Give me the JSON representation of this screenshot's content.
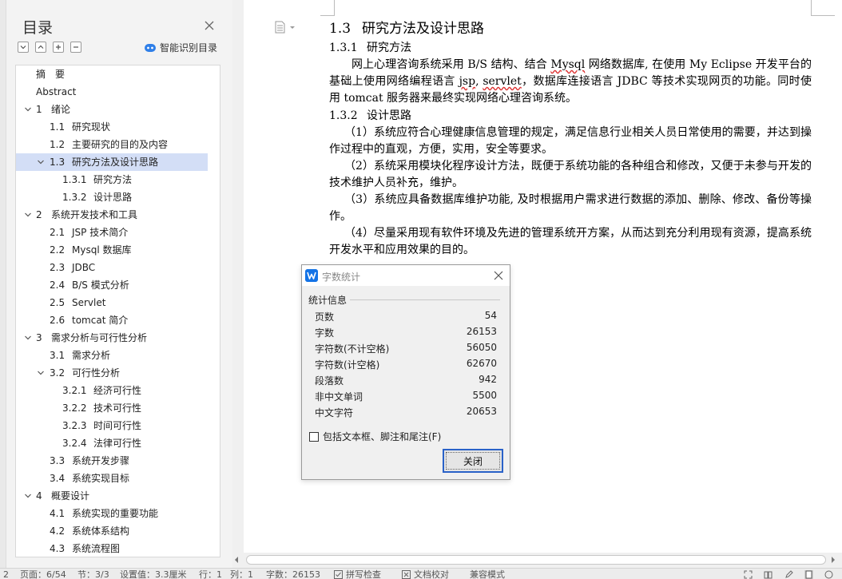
{
  "toc": {
    "title": "目录",
    "smart_toc_label": "智能识别目录",
    "items": [
      {
        "num": "",
        "text": "摘　要",
        "level": 1,
        "chevron": "none"
      },
      {
        "num": "",
        "text": "Abstract",
        "level": 1,
        "chevron": "none"
      },
      {
        "num": "1",
        "text": "绪论",
        "level": 1,
        "chevron": "down"
      },
      {
        "num": "1.1",
        "text": "研究现状",
        "level": 2,
        "chevron": "none"
      },
      {
        "num": "1.2",
        "text": "主要研究的目的及内容",
        "level": 2,
        "chevron": "none"
      },
      {
        "num": "1.3",
        "text": "研究方法及设计思路",
        "level": 2,
        "chevron": "down",
        "selected": true
      },
      {
        "num": "1.3.1",
        "text": "研究方法",
        "level": 3,
        "chevron": "none"
      },
      {
        "num": "1.3.2",
        "text": "设计思路",
        "level": 3,
        "chevron": "none"
      },
      {
        "num": "2",
        "text": "系统开发技术和工具",
        "level": 1,
        "chevron": "down"
      },
      {
        "num": "2.1",
        "text": "JSP 技术简介",
        "level": 2,
        "chevron": "none"
      },
      {
        "num": "2.2",
        "text": "Mysql 数据库",
        "level": 2,
        "chevron": "none"
      },
      {
        "num": "2.3",
        "text": "JDBC",
        "level": 2,
        "chevron": "none"
      },
      {
        "num": "2.4",
        "text": "B/S 模式分析",
        "level": 2,
        "chevron": "none"
      },
      {
        "num": "2.5",
        "text": "Servlet",
        "level": 2,
        "chevron": "none"
      },
      {
        "num": "2.6",
        "text": "tomcat 简介",
        "level": 2,
        "chevron": "none"
      },
      {
        "num": "3",
        "text": "需求分析与可行性分析",
        "level": 1,
        "chevron": "down"
      },
      {
        "num": "3.1",
        "text": "需求分析",
        "level": 2,
        "chevron": "none"
      },
      {
        "num": "3.2",
        "text": "可行性分析",
        "level": 2,
        "chevron": "down"
      },
      {
        "num": "3.2.1",
        "text": "经济可行性",
        "level": 3,
        "chevron": "none"
      },
      {
        "num": "3.2.2",
        "text": "技术可行性",
        "level": 3,
        "chevron": "none"
      },
      {
        "num": "3.2.3",
        "text": "时间可行性",
        "level": 3,
        "chevron": "none"
      },
      {
        "num": "3.2.4",
        "text": "法律可行性",
        "level": 3,
        "chevron": "none"
      },
      {
        "num": "3.3",
        "text": "系统开发步骤",
        "level": 2,
        "chevron": "none"
      },
      {
        "num": "3.4",
        "text": "系统实现目标",
        "level": 2,
        "chevron": "none"
      },
      {
        "num": "4",
        "text": "概要设计",
        "level": 1,
        "chevron": "down"
      },
      {
        "num": "4.1",
        "text": "系统实现的重要功能",
        "level": 2,
        "chevron": "none"
      },
      {
        "num": "4.2",
        "text": "系统体系结构",
        "level": 2,
        "chevron": "none"
      },
      {
        "num": "4.3",
        "text": "系统流程图",
        "level": 2,
        "chevron": "none"
      }
    ]
  },
  "document": {
    "h_1_3_num": "1.3",
    "h_1_3_text": "研究方法及设计思路",
    "h_1_3_1_num": "1.3.1",
    "h_1_3_1_text": "研究方法",
    "p1_a": "网上心理咨询系统采用 B/S 结构、结合 ",
    "p1_mysql": "Mysql",
    "p1_b": " 网络数据库, 在使用 My Eclipse 开发平台的基础上使用网络编程语言 ",
    "p1_jsp": "jsp",
    "p1_c": ", ",
    "p1_servlet": "servlet",
    "p1_d": "，数据库连接语言 JDBC 等技术实现网页的功能。同时使用 tomcat 服务器来最终实现网络心理咨询系统。",
    "h_1_3_2_num": "1.3.2",
    "h_1_3_2_text": "设计思路",
    "p2": "（1）系统应符合心理健康信息管理的规定，满足信息行业相关人员日常使用的需要，并达到操作过程中的直观，方便，实用，安全等要求。",
    "p3": "（2）系统采用模块化程序设计方法，既便于系统功能的各种组合和修改，又便于未参与开发的技术维护人员补充，维护。",
    "p4": "（3）系统应具备数据库维护功能, 及时根据用户需求进行数据的添加、删除、修改、备份等操作。",
    "p5": "（4）尽量采用现有软件环境及先进的管理系统开方案，从而达到充分利用现有资源，提高系统开发水平和应用效果的目的。"
  },
  "dialog": {
    "title": "字数统计",
    "group_label": "统计信息",
    "stats": [
      {
        "label": "页数",
        "value": "54"
      },
      {
        "label": "字数",
        "value": "26153"
      },
      {
        "label": "字符数(不计空格)",
        "value": "56050"
      },
      {
        "label": "字符数(计空格)",
        "value": "62670"
      },
      {
        "label": "段落数",
        "value": "942"
      },
      {
        "label": "非中文单词",
        "value": "5500"
      },
      {
        "label": "中文字符",
        "value": "20653"
      }
    ],
    "checkbox_label": "包括文本框、脚注和尾注(F)",
    "close_button": "关闭"
  },
  "statusbar": {
    "frag": "2",
    "page": "页面：6/54",
    "section": "节：3/3",
    "setting": "设置值：3.3厘米",
    "row": "行：1",
    "col": "列：1",
    "words": "字数：26153",
    "spell": "拼写检查",
    "proof": "文档校对",
    "compat": "兼容模式"
  },
  "colors": {
    "selected_bg": "#d3def6",
    "accent_blue": "#1473e6",
    "button_border": "#2a62c8"
  }
}
